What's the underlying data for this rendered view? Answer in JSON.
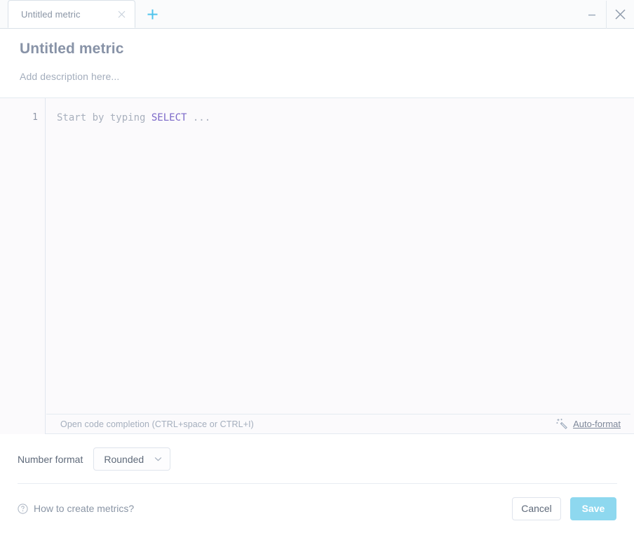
{
  "window": {
    "minimize_icon": "minimize-icon",
    "close_icon": "close-icon"
  },
  "tabs": {
    "items": [
      {
        "label": "Untitled metric",
        "close_icon": "close-icon",
        "active": true
      }
    ],
    "new_tab_icon": "plus-icon",
    "new_tab_label": "+"
  },
  "header": {
    "title": "Untitled metric",
    "description_placeholder": "Add description here..."
  },
  "editor": {
    "line_numbers": [
      "1"
    ],
    "placeholder_prefix": "Start by typing ",
    "placeholder_keyword": "SELECT",
    "placeholder_suffix": " ...",
    "status_hint": "Open code completion (CTRL+space or CTRL+I)",
    "autoformat_label": "Auto-format",
    "autoformat_icon": "magic-wand-icon"
  },
  "number_format": {
    "label": "Number format",
    "selected": "Rounded",
    "chevron_icon": "chevron-down-icon",
    "options": [
      "Rounded"
    ]
  },
  "footer": {
    "help_icon": "question-circle-icon",
    "help_label": "How to create metrics?",
    "cancel_label": "Cancel",
    "save_label": "Save"
  },
  "colors": {
    "accent": "#4ec3ec",
    "save_button": "#8ed8ef",
    "keyword": "#7b68c8",
    "title_text": "#8893a7",
    "muted_text": "#a4aebd"
  }
}
